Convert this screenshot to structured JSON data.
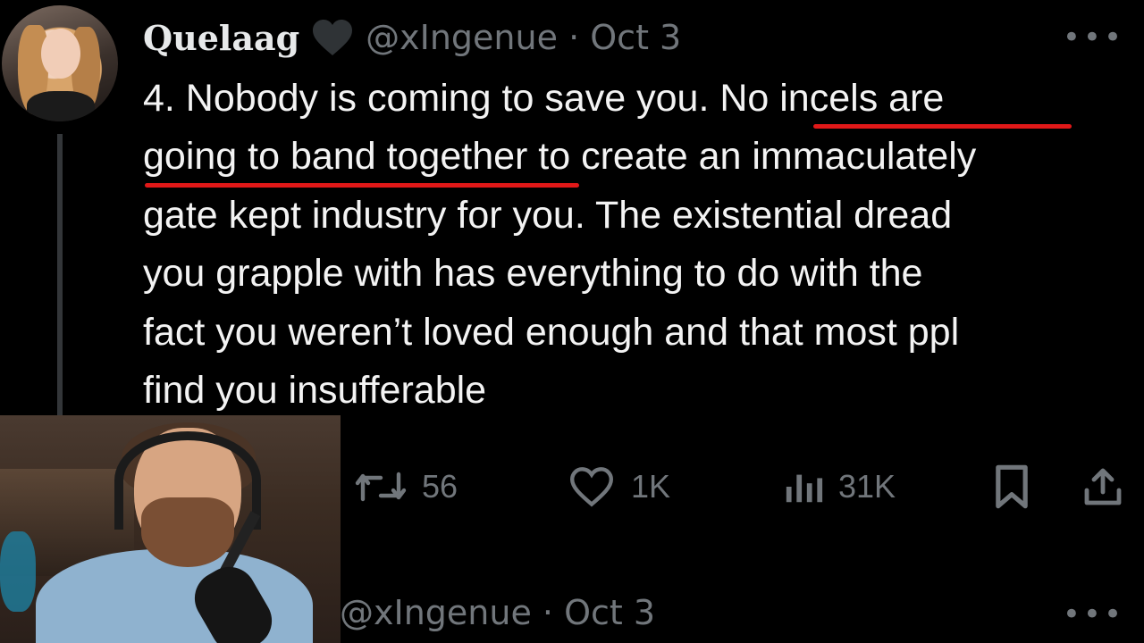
{
  "tweet": {
    "author": {
      "display_name": "Quelaag",
      "handle": "@xIngenue",
      "date": "Oct 3",
      "separator": "·",
      "badge_icon": "heart-icon"
    },
    "text_lines": [
      "4. Nobody is coming to save you. No incels are",
      "going to band together to create an immaculately",
      "gate kept industry for you. The existential dread",
      "you grapple with has everything to do with the",
      "fact you weren’t loved enough and that most ppl",
      "find you insufferable"
    ],
    "text_parts": {
      "l1_plain": "4. Nobody is coming to save you. ",
      "l1_highlight": "No incels are",
      "l2_highlight": "going to band together",
      "l2_plain": " to create an immaculately"
    },
    "highlight_color": "#e01818",
    "more_label": "•••",
    "actions": {
      "retweets": "56",
      "likes": "1K",
      "views": "31K"
    },
    "icons": [
      "retweet-icon",
      "like-icon",
      "views-icon",
      "bookmark-icon",
      "share-icon"
    ]
  },
  "reply": {
    "handle": "@xIngenue",
    "separator": "·",
    "date": "Oct 3",
    "more_label": "•••"
  },
  "colors": {
    "background": "#000000",
    "text": "#e7e9ea",
    "muted": "#71767b",
    "thread_line": "#333639"
  }
}
